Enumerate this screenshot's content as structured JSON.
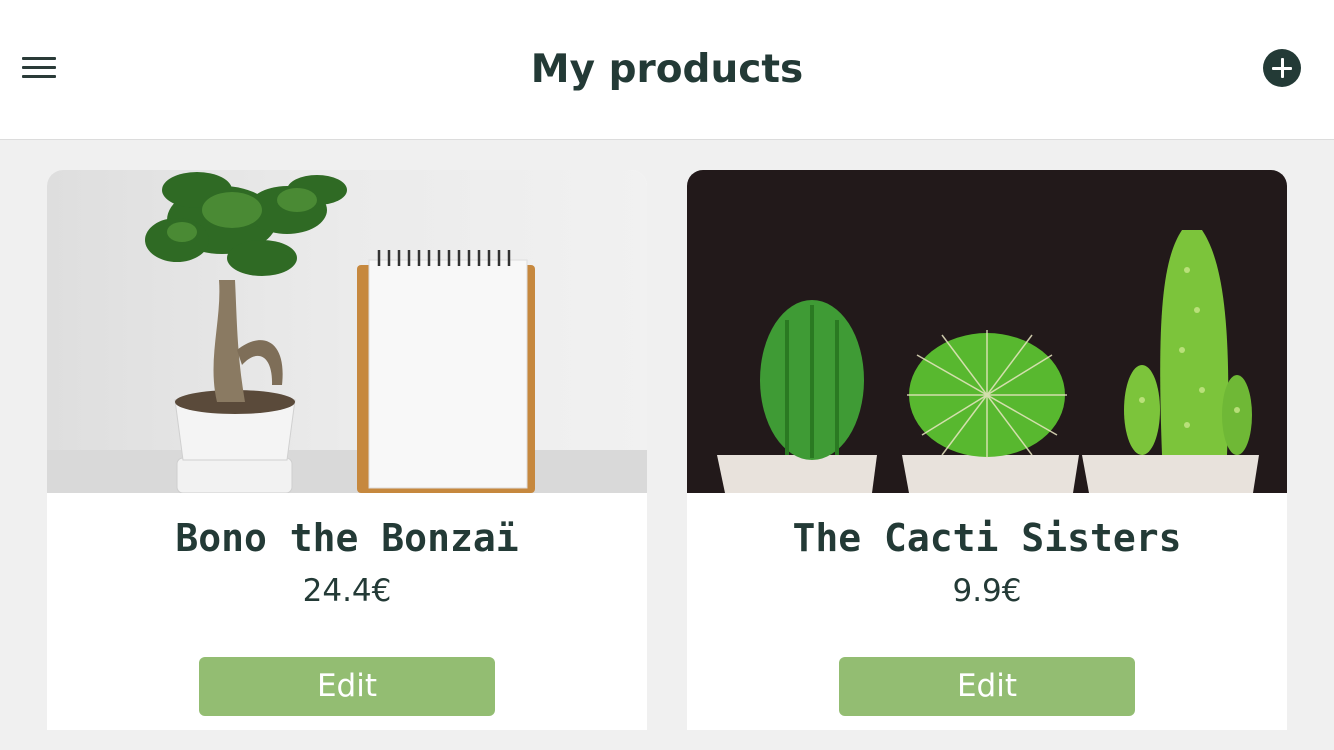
{
  "header": {
    "title": "My products",
    "menu_icon": "hamburger-menu-icon",
    "add_icon": "plus-circle-icon"
  },
  "products": [
    {
      "name": "Bono the Bonzaï",
      "price": "24.4€",
      "edit_label": "Edit",
      "image": "bonsai-photo"
    },
    {
      "name": "The Cacti Sisters",
      "price": "9.9€",
      "edit_label": "Edit",
      "image": "cacti-photo"
    }
  ],
  "colors": {
    "primary": "#233a36",
    "button": "#93bd72",
    "background": "#f0f0f0",
    "card": "#ffffff"
  }
}
